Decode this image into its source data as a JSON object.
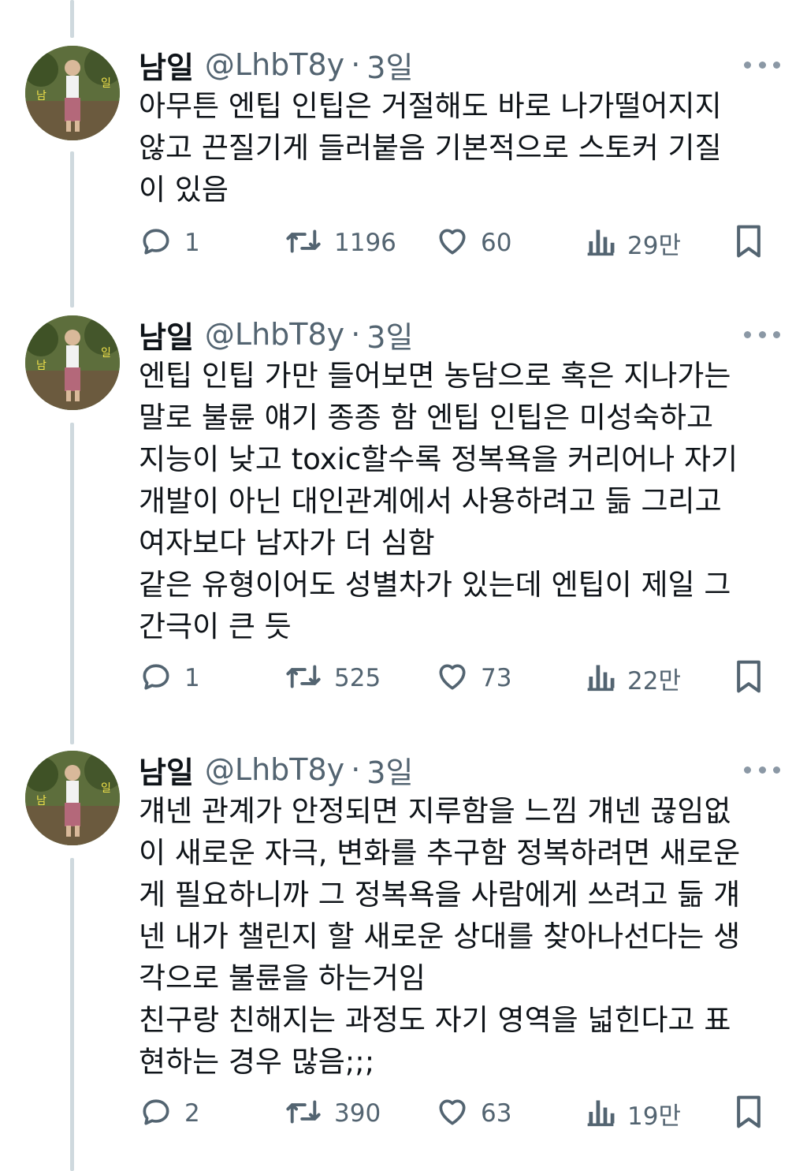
{
  "colors": {
    "text": "#0f1419",
    "secondary": "#536471",
    "thread_line": "#cfd9de",
    "icon": "#536471"
  },
  "tweets": [
    {
      "name": "남일",
      "handle": "@LhbT8y",
      "separator": "·",
      "time": "3일",
      "lines": [
        "아무튼 엔팁 인팁은 거절해도 바로 나가떨어지지",
        "않고 끈질기게 들러붙음 기본적으로 스토커 기질",
        "이 있음"
      ],
      "reply_count": "1",
      "retweet_count": "1196",
      "like_count": "60",
      "view_count": "29만"
    },
    {
      "name": "남일",
      "handle": "@LhbT8y",
      "separator": "·",
      "time": "3일",
      "lines": [
        "엔팁 인팁 가만 들어보면 농담으로 혹은 지나가는",
        "말로 불륜 얘기 종종 함 엔팁 인팁은 미성숙하고",
        "지능이 낮고 toxic할수록 정복욕을 커리어나 자기",
        "개발이 아닌 대인관계에서 사용하려고 듦 그리고",
        "여자보다 남자가 더 심함",
        "같은 유형이어도 성별차가 있는데 엔팁이 제일 그",
        "간극이 큰 듯"
      ],
      "reply_count": "1",
      "retweet_count": "525",
      "like_count": "73",
      "view_count": "22만"
    },
    {
      "name": "남일",
      "handle": "@LhbT8y",
      "separator": "·",
      "time": "3일",
      "lines": [
        "걔넨 관계가 안정되면 지루함을 느낌 걔넨 끊임없",
        "이 새로운 자극, 변화를 추구함 정복하려면 새로운",
        "게 필요하니까 그 정복욕을 사람에게 쓰려고 듦 걔",
        "넨 내가 챌린지 할 새로운 상대를 찾아나선다는 생",
        "각으로 불륜을 하는거임",
        "친구랑 친해지는 과정도 자기 영역을 넓힌다고 표",
        "현하는 경우 많음;;;"
      ],
      "reply_count": "2",
      "retweet_count": "390",
      "like_count": "63",
      "view_count": "19만"
    }
  ]
}
